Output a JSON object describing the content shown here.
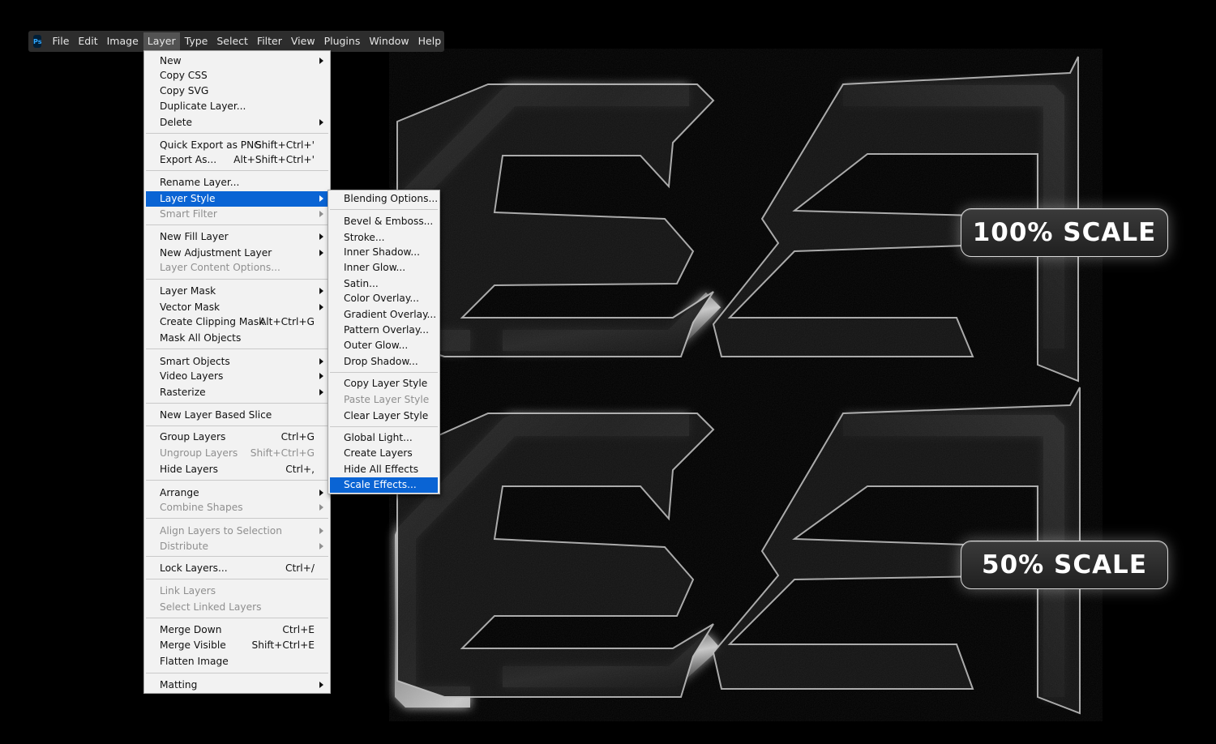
{
  "app": {
    "logo_text": "Ps"
  },
  "menubar": {
    "items": [
      "File",
      "Edit",
      "Image",
      "Layer",
      "Type",
      "Select",
      "Filter",
      "View",
      "Plugins",
      "Window",
      "Help"
    ],
    "active": "Layer"
  },
  "layer_menu": {
    "new": "New",
    "copy_css": "Copy CSS",
    "copy_svg": "Copy SVG",
    "duplicate_layer": "Duplicate Layer...",
    "delete": "Delete",
    "quick_export": "Quick Export as PNG",
    "quick_export_shortcut": "Shift+Ctrl+'",
    "export_as": "Export As...",
    "export_as_shortcut": "Alt+Shift+Ctrl+'",
    "rename_layer": "Rename Layer...",
    "layer_style": "Layer Style",
    "smart_filter": "Smart Filter",
    "new_fill_layer": "New Fill Layer",
    "new_adjustment_layer": "New Adjustment Layer",
    "layer_content_options": "Layer Content Options...",
    "layer_mask": "Layer Mask",
    "vector_mask": "Vector Mask",
    "create_clipping_mask": "Create Clipping Mask",
    "create_clipping_mask_shortcut": "Alt+Ctrl+G",
    "mask_all_objects": "Mask All Objects",
    "smart_objects": "Smart Objects",
    "video_layers": "Video Layers",
    "rasterize": "Rasterize",
    "new_layer_based_slice": "New Layer Based Slice",
    "group_layers": "Group Layers",
    "group_layers_shortcut": "Ctrl+G",
    "ungroup_layers": "Ungroup Layers",
    "ungroup_layers_shortcut": "Shift+Ctrl+G",
    "hide_layers": "Hide Layers",
    "hide_layers_shortcut": "Ctrl+,",
    "arrange": "Arrange",
    "combine_shapes": "Combine Shapes",
    "align_layers": "Align Layers to Selection",
    "distribute": "Distribute",
    "lock_layers": "Lock Layers...",
    "lock_layers_shortcut": "Ctrl+/",
    "link_layers": "Link Layers",
    "select_linked_layers": "Select Linked Layers",
    "merge_down": "Merge Down",
    "merge_down_shortcut": "Ctrl+E",
    "merge_visible": "Merge Visible",
    "merge_visible_shortcut": "Shift+Ctrl+E",
    "flatten_image": "Flatten Image",
    "matting": "Matting"
  },
  "layer_style_menu": {
    "blending_options": "Blending Options...",
    "bevel_emboss": "Bevel & Emboss...",
    "stroke": "Stroke...",
    "inner_shadow": "Inner Shadow...",
    "inner_glow": "Inner Glow...",
    "satin": "Satin...",
    "color_overlay": "Color Overlay...",
    "gradient_overlay": "Gradient Overlay...",
    "pattern_overlay": "Pattern Overlay...",
    "outer_glow": "Outer Glow...",
    "drop_shadow": "Drop Shadow...",
    "copy_layer_style": "Copy Layer Style",
    "paste_layer_style": "Paste Layer Style",
    "clear_layer_style": "Clear Layer Style",
    "global_light": "Global Light...",
    "create_layers": "Create Layers",
    "hide_all_effects": "Hide All Effects",
    "scale_effects": "Scale Effects..."
  },
  "badges": {
    "top": "100% SCALE",
    "bottom": "50% SCALE"
  },
  "colors": {
    "highlight": "#0a64d4",
    "menu_bg": "#f2f2f2",
    "menubar_bg": "#2d2d2d"
  }
}
